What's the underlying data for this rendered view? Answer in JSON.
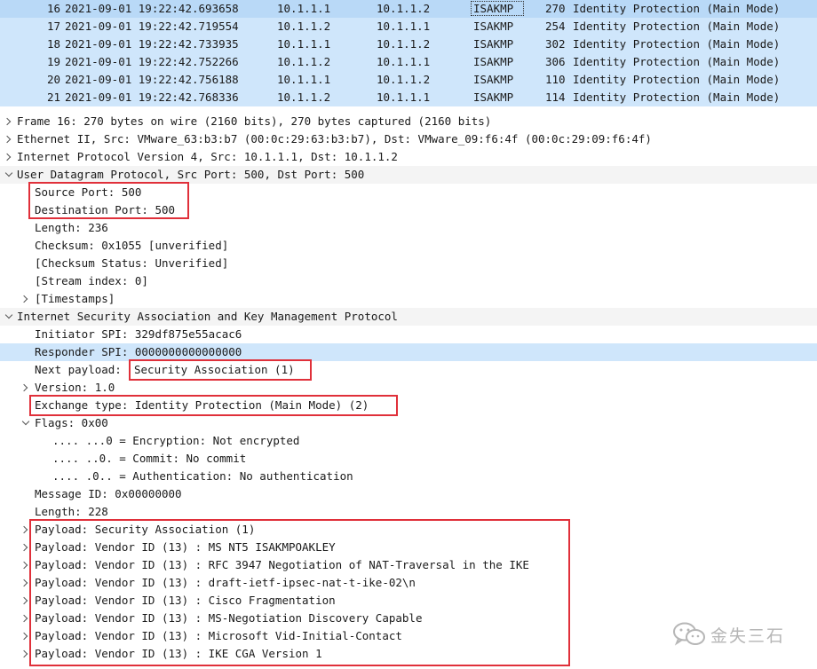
{
  "packet_list": {
    "rows": [
      {
        "no": "16",
        "time": "2021-09-01 19:22:42.693658",
        "src": "10.1.1.1",
        "dst": "10.1.1.2",
        "proto": "ISAKMP",
        "len": "270",
        "info": "Identity Protection (Main Mode)"
      },
      {
        "no": "17",
        "time": "2021-09-01 19:22:42.719554",
        "src": "10.1.1.2",
        "dst": "10.1.1.1",
        "proto": "ISAKMP",
        "len": "254",
        "info": "Identity Protection (Main Mode)"
      },
      {
        "no": "18",
        "time": "2021-09-01 19:22:42.733935",
        "src": "10.1.1.1",
        "dst": "10.1.1.2",
        "proto": "ISAKMP",
        "len": "302",
        "info": "Identity Protection (Main Mode)"
      },
      {
        "no": "19",
        "time": "2021-09-01 19:22:42.752266",
        "src": "10.1.1.2",
        "dst": "10.1.1.1",
        "proto": "ISAKMP",
        "len": "306",
        "info": "Identity Protection (Main Mode)"
      },
      {
        "no": "20",
        "time": "2021-09-01 19:22:42.756188",
        "src": "10.1.1.1",
        "dst": "10.1.1.2",
        "proto": "ISAKMP",
        "len": "110",
        "info": "Identity Protection (Main Mode)"
      },
      {
        "no": "21",
        "time": "2021-09-01 19:22:42.768336",
        "src": "10.1.1.2",
        "dst": "10.1.1.1",
        "proto": "ISAKMP",
        "len": "114",
        "info": "Identity Protection (Main Mode)"
      }
    ]
  },
  "details": {
    "frame": "Frame 16: 270 bytes on wire (2160 bits), 270 bytes captured (2160 bits)",
    "ethernet": "Ethernet II, Src: VMware_63:b3:b7 (00:0c:29:63:b3:b7), Dst: VMware_09:f6:4f (00:0c:29:09:f6:4f)",
    "ip": "Internet Protocol Version 4, Src: 10.1.1.1, Dst: 10.1.1.2",
    "udp": "User Datagram Protocol, Src Port: 500, Dst Port: 500",
    "udp_fields": {
      "src_port": "Source Port: 500",
      "dst_port": "Destination Port: 500",
      "length": "Length: 236",
      "checksum": "Checksum: 0x1055 [unverified]",
      "checksum_status": "[Checksum Status: Unverified]",
      "stream_index": "[Stream index: 0]",
      "timestamps": "[Timestamps]"
    },
    "isakmp": "Internet Security Association and Key Management Protocol",
    "isakmp_fields": {
      "initiator_spi": "Initiator SPI: 329df875e55acac6",
      "responder_spi": "Responder SPI: 0000000000000000",
      "next_payload_label": "Next payload: ",
      "next_payload_value": "Security Association (1)",
      "version": "Version: 1.0",
      "exchange_type": "Exchange type: Identity Protection (Main Mode) (2)",
      "flags": "Flags: 0x00",
      "flag_encryption": ".... ...0 = Encryption: Not encrypted",
      "flag_commit": ".... ..0. = Commit: No commit",
      "flag_auth": ".... .0.. = Authentication: No authentication",
      "message_id": "Message ID: 0x00000000",
      "length": "Length: 228"
    },
    "payloads": [
      "Payload: Security Association (1)",
      "Payload: Vendor ID (13) : MS NT5 ISAKMPOAKLEY",
      "Payload: Vendor ID (13) : RFC 3947 Negotiation of NAT-Traversal in the IKE",
      "Payload: Vendor ID (13) : draft-ietf-ipsec-nat-t-ike-02\\n",
      "Payload: Vendor ID (13) : Cisco Fragmentation",
      "Payload: Vendor ID (13) : MS-Negotiation Discovery Capable",
      "Payload: Vendor ID (13) : Microsoft Vid-Initial-Contact",
      "Payload: Vendor ID (13) : IKE CGA Version 1"
    ]
  },
  "watermark": {
    "text": "金失三石",
    "icon": "wechat-icon"
  },
  "colors": {
    "row_bg": "#cfe6fb",
    "selected_row_bg": "#b9d9f7",
    "highlight_box": "#e0303a"
  }
}
